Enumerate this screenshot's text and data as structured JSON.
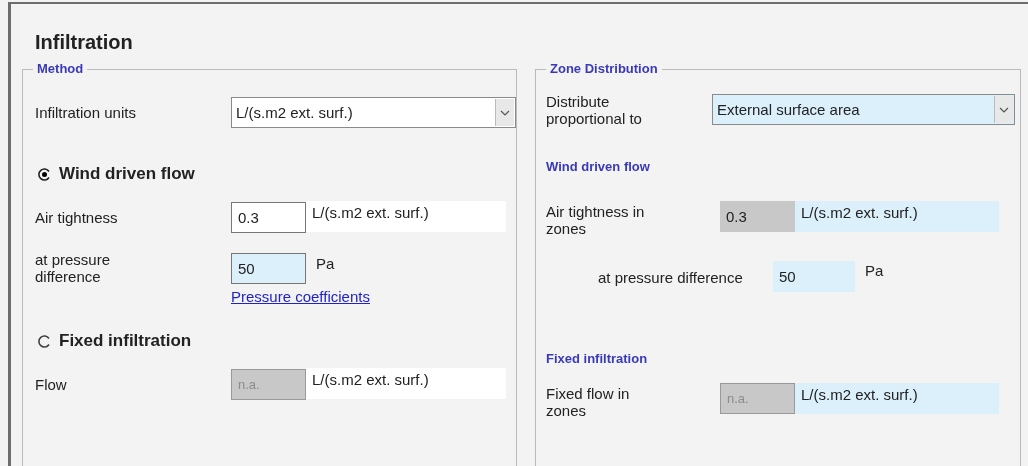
{
  "title": "Infiltration",
  "method": {
    "legend": "Method",
    "units": {
      "label": "Infiltration units",
      "value": "L/(s.m2 ext. surf.)",
      "highlighted": false
    },
    "options": [
      {
        "label": "Wind driven flow",
        "selected": true,
        "link": "Pressure coefficients",
        "fields": [
          {
            "label": "Air tightness",
            "value": "0.3",
            "kind": "editable",
            "unit": "L/(s.m2 ext. surf.)",
            "unit_boxed": true,
            "unit_highlighted": false
          },
          {
            "label": "at pressure difference",
            "value": "50",
            "kind": "highlighted",
            "unit": "Pa",
            "unit_boxed": false,
            "unit_highlighted": false
          }
        ]
      },
      {
        "label": "Fixed infiltration",
        "selected": false,
        "fields": [
          {
            "label": "Flow",
            "value": "n.a.",
            "kind": "disabled",
            "unit": "L/(s.m2 ext. surf.)",
            "unit_boxed": true,
            "unit_highlighted": false
          }
        ]
      }
    ]
  },
  "zone_distribution": {
    "legend": "Zone Distribution",
    "distribute": {
      "label": "Distribute proportional to",
      "value": "External surface area",
      "highlighted": true
    },
    "sections": [
      {
        "heading": "Wind driven flow",
        "fields": [
          {
            "label": "Air tightness in zones",
            "value": "0.3",
            "kind": "readonly",
            "unit": "L/(s.m2 ext. surf.)",
            "unit_boxed": true,
            "unit_highlighted": true,
            "indented": false
          },
          {
            "label": "at pressure difference",
            "value": "50",
            "kind": "calculated",
            "unit": "Pa",
            "unit_boxed": false,
            "unit_highlighted": false,
            "indented": true
          }
        ]
      },
      {
        "heading": "Fixed infiltration",
        "fields": [
          {
            "label": "Fixed flow in zones",
            "value": "n.a.",
            "kind": "disabled",
            "unit": "L/(s.m2 ext. surf.)",
            "unit_boxed": true,
            "unit_highlighted": true,
            "indented": false
          }
        ]
      }
    ]
  }
}
